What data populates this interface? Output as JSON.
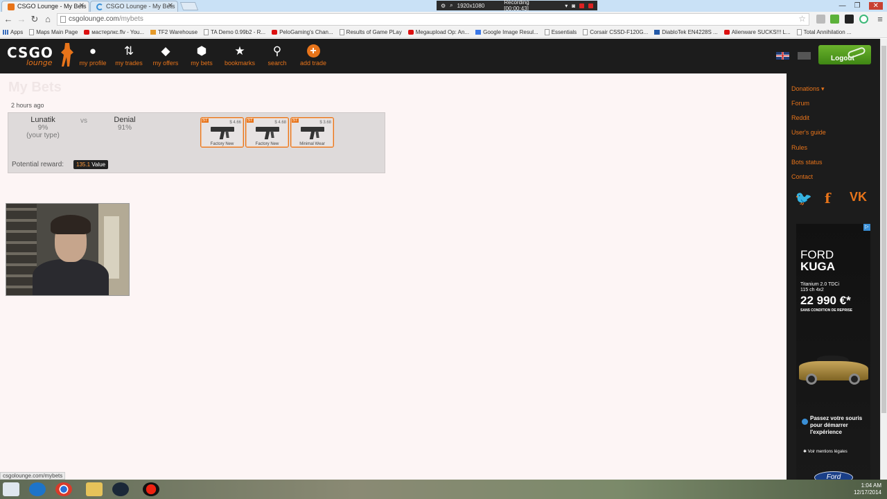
{
  "browser": {
    "tabs": [
      {
        "label": "CSGO Lounge - My Bets"
      },
      {
        "label": "CSGO Lounge - My Bets"
      }
    ],
    "url_host": "csgolounge.com",
    "url_path": "/mybets",
    "status_url": "csgolounge.com/mybets",
    "recorder": {
      "resolution": "1920x1080",
      "status": "Recording [00:00:43]"
    },
    "bookmarks": [
      {
        "label": "Apps",
        "icon": "grid"
      },
      {
        "label": "Maps Main Page",
        "icon": "doc"
      },
      {
        "label": "мастерлкс.flv - You...",
        "icon": "yt"
      },
      {
        "label": "TF2 Warehouse",
        "icon": "tf"
      },
      {
        "label": "TA Demo 0.99b2 - R...",
        "icon": "doc"
      },
      {
        "label": "PeloGaming's Chan...",
        "icon": "yt"
      },
      {
        "label": "Results of Game PLay",
        "icon": "doc"
      },
      {
        "label": "Megaupload Op: An...",
        "icon": "yt"
      },
      {
        "label": "Google Image Resul...",
        "icon": "g"
      },
      {
        "label": "Essentials",
        "icon": "doc"
      },
      {
        "label": "Corsair CSSD-F120G...",
        "icon": "doc"
      },
      {
        "label": "DiabloTek EN4228S ...",
        "icon": "blue"
      },
      {
        "label": "Alienware SUCKS!!! L...",
        "icon": "yt"
      },
      {
        "label": "Total Annihilation ...",
        "icon": "doc"
      }
    ]
  },
  "site": {
    "logo_main": "CSGO",
    "logo_sub": "lounge",
    "nav": [
      {
        "label": "my profile",
        "icon": "person-icon"
      },
      {
        "label": "my trades",
        "icon": "trades-icon"
      },
      {
        "label": "my offers",
        "icon": "tag-icon"
      },
      {
        "label": "my bets",
        "icon": "dice-icon"
      },
      {
        "label": "bookmarks",
        "icon": "star-icon"
      },
      {
        "label": "search",
        "icon": "search-icon"
      },
      {
        "label": "add trade",
        "icon": "plus-icon"
      }
    ],
    "logout_label": "Logout"
  },
  "main": {
    "title": "My Bets",
    "bet": {
      "time_ago": "2 hours ago",
      "team1": {
        "name": "Lunatik",
        "percent": "9%",
        "note": "(your type)"
      },
      "vs": "vs",
      "team2": {
        "name": "Denial",
        "percent": "91%"
      },
      "items": [
        {
          "tag": "ST",
          "price": "$ 4.66",
          "wear": "Factory New"
        },
        {
          "tag": "ST",
          "price": "$ 4.68",
          "wear": "Factory New"
        },
        {
          "tag": "ST",
          "price": "$ 3.68",
          "wear": "Minimal Wear"
        }
      ],
      "reward_label": "Potential reward:",
      "reward_value": "135.1",
      "reward_unit": "Value"
    }
  },
  "sidebar": {
    "links": [
      "Donations ▾",
      "Forum",
      "Reddit",
      "User's guide",
      "Rules",
      "Bots status",
      "Contact"
    ],
    "ad": {
      "brand": "FORD",
      "model": "KUGA",
      "spec1": "Titanium 2.0 TDCi",
      "spec2": "115 ch 4x2",
      "price": "22 990 €*",
      "condition": "SANS CONDITION DE REPRISE",
      "cta": "Passez votre souris pour démarrer l'expérience",
      "legal": "Voir mentions légales",
      "logo": "Ford"
    }
  },
  "taskbar": {
    "time": "1:04 AM",
    "date": "12/17/2014"
  }
}
